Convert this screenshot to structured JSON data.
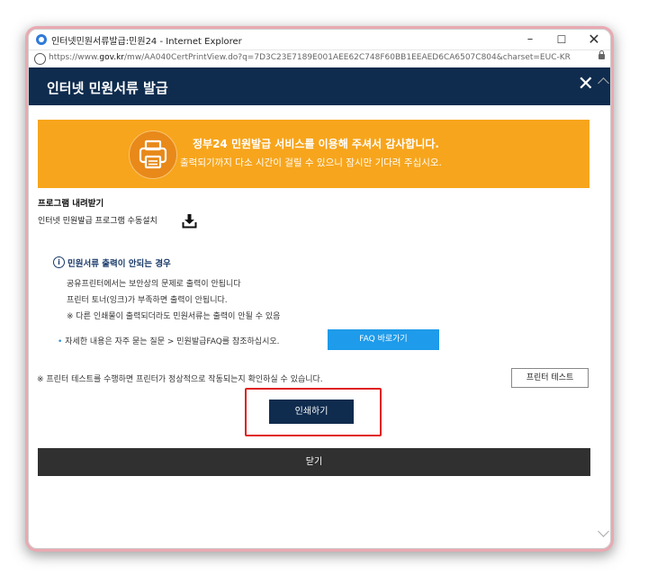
{
  "window": {
    "title": "인터넷민원서류발급:민원24 - Internet Explorer",
    "minimize_glyph": "–",
    "maximize_glyph": "☐",
    "close_glyph": "✕",
    "url_prefix": "https://www.",
    "url_domain": "gov.kr",
    "url_rest": "/mw/AA040CertPrintView.do?q=7D3C23E7189E001AEE62C748F60BB1EEAED6CA6507C804&charset=EUC-KR"
  },
  "header": {
    "title": "인터넷 민원서류 발급",
    "close_glyph": "✕",
    "bg_color": "#0f2c4e"
  },
  "banner": {
    "line1": "정부24 민원발급 서비스를 이용해 주셔서 감사합니다.",
    "line2": "출력되기까지 다소 시간이 걸릴 수 있으니 잠시만 기다려 주십시오.",
    "bg_color": "#f7a51c",
    "icon": "printer-icon"
  },
  "program": {
    "section_title": "프로그램 내려받기",
    "install_label": "인터넷 민원발급 프로그램 수동설치",
    "icon": "download-icon"
  },
  "info": {
    "title": "민원서류 출력이 안되는 경우",
    "lines": [
      "공유프린터에서는 보안상의 문제로 출력이 안됩니다",
      "프린터 토너(잉크)가 부족하면 출력이 안됩니다.",
      "※ 다른 인쇄물이 출력되더라도 민원서류는 출력이 안될 수 있음"
    ],
    "faq_text": "자세한 내용은 자주 묻는 질문 > 민원발급FAQ를 참조하십시오.",
    "faq_button": "FAQ 바로가기"
  },
  "printer_test": {
    "note": "※ 프린터 테스트를 수행하면 프린터가 정상적으로 작동되는지 확인하실 수 있습니다.",
    "button": "프린터 테스트"
  },
  "actions": {
    "print_button": "인쇄하기",
    "close_button": "닫기"
  }
}
